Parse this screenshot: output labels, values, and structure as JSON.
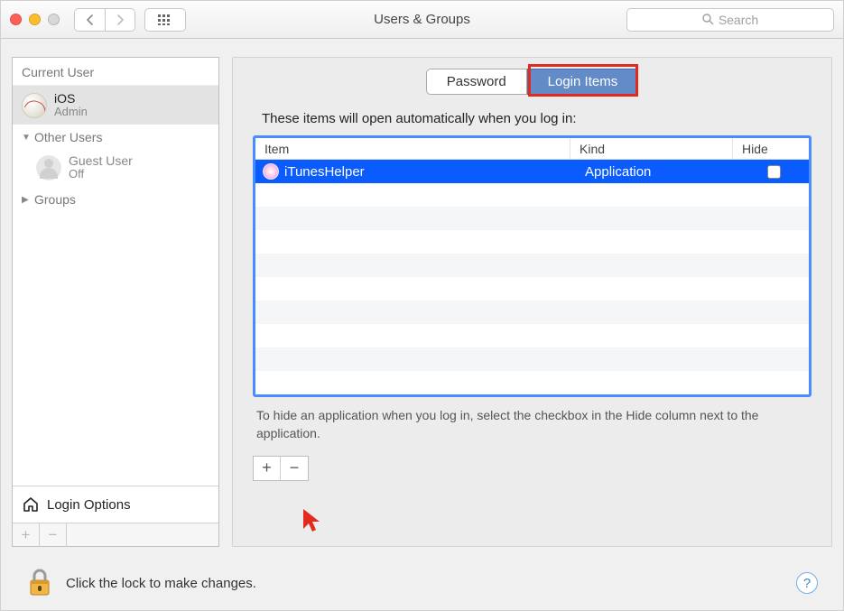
{
  "window": {
    "title": "Users & Groups"
  },
  "search": {
    "placeholder": "Search"
  },
  "sidebar": {
    "current_label": "Current User",
    "current_user": {
      "name": "iOS",
      "role": "Admin"
    },
    "other_label": "Other Users",
    "guest": {
      "name": "Guest User",
      "status": "Off"
    },
    "groups_label": "Groups",
    "login_options": "Login Options"
  },
  "tabs": {
    "password": "Password",
    "login_items": "Login Items"
  },
  "main": {
    "instruction": "These items will open automatically when you log in:",
    "columns": {
      "item": "Item",
      "kind": "Kind",
      "hide": "Hide"
    },
    "rows": [
      {
        "name": "iTunesHelper",
        "kind": "Application",
        "hide": false
      }
    ],
    "hint": "To hide an application when you log in, select the checkbox in the Hide column next to the application."
  },
  "footer": {
    "lock_text": "Click the lock to make changes."
  }
}
